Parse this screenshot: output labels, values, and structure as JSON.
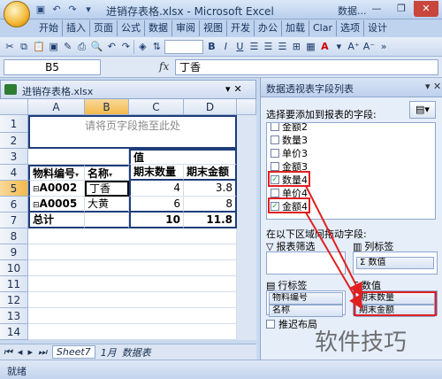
{
  "titlebar": {
    "title": "进销存表格.xlsx - Microsoft Excel",
    "pivot_title": "数据..."
  },
  "ribbon": {
    "tabs": [
      "开始",
      "插入",
      "页面",
      "公式",
      "数据",
      "审阅",
      "视图",
      "开发",
      "办公",
      "加载",
      "Clar",
      "选项",
      "设计"
    ]
  },
  "toolbar": {
    "font_size": "",
    "bold": "B",
    "italic": "I",
    "underline": "U",
    "font_color": "A"
  },
  "formula_bar": {
    "name_box": "B5",
    "fx": "fx",
    "value": "丁香"
  },
  "workbook": {
    "name": "进销存表格.xlsx"
  },
  "grid": {
    "columns": [
      "A",
      "B",
      "C",
      "D"
    ],
    "rows": [
      "1",
      "2",
      "3",
      "4",
      "5",
      "6",
      "7",
      "8",
      "9",
      "10",
      "11",
      "12",
      "13",
      "14"
    ],
    "page_field_hint": "请将页字段拖至此处",
    "value_header": "值",
    "headers": [
      "物料编号",
      "名称",
      "期末数量",
      "期末金额"
    ],
    "data": [
      [
        "A0002",
        "丁香",
        "4",
        "3.8"
      ],
      [
        "A0005",
        "大黄",
        "6",
        "8"
      ]
    ],
    "total": [
      "总计",
      "",
      "10",
      "11.8"
    ]
  },
  "sheet_tabs": [
    "Sheet7",
    "1月",
    "数据表"
  ],
  "status": {
    "text": "就绪"
  },
  "pivot_panel": {
    "title": "数据透视表字段列表",
    "prompt": "选择要添加到报表的字段:",
    "fields": [
      {
        "label": "金额2",
        "checked": false
      },
      {
        "label": "数量3",
        "checked": false
      },
      {
        "label": "单价3",
        "checked": false
      },
      {
        "label": "金额3",
        "checked": false
      },
      {
        "label": "数量4",
        "checked": true
      },
      {
        "label": "单价4",
        "checked": false
      },
      {
        "label": "金额4",
        "checked": true
      }
    ],
    "drag_label": "在以下区域间拖动字段:",
    "report_filter": "报表筛选",
    "column_labels": "列标签",
    "column_value": "Σ 数值",
    "row_labels": "行标签",
    "values": "数值",
    "row_items": [
      "物料编号",
      "名称"
    ],
    "value_items": [
      "期末数量",
      "期末金额"
    ],
    "defer": "推迟布局"
  },
  "watermark": "软件技巧"
}
